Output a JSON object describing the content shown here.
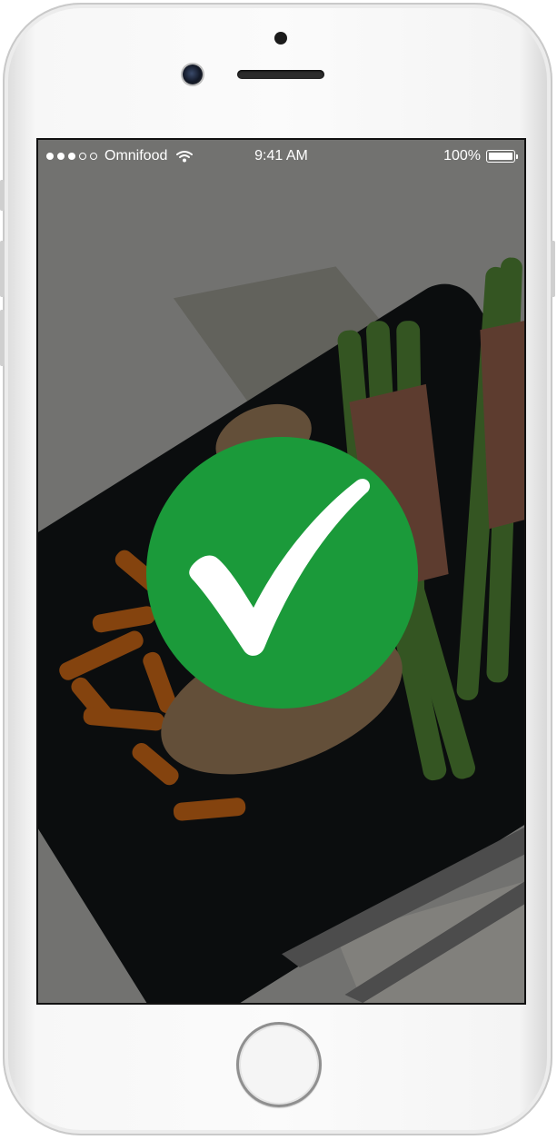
{
  "status_bar": {
    "signal_bars": 5,
    "signal_filled": 3,
    "carrier": "Omnifood",
    "time": "9:41 AM",
    "battery_text": "100%",
    "battery_level": 1.0
  },
  "screen": {
    "background": "food-photo",
    "overlay": "check-icon",
    "accent_color": "#1b9a3a"
  }
}
